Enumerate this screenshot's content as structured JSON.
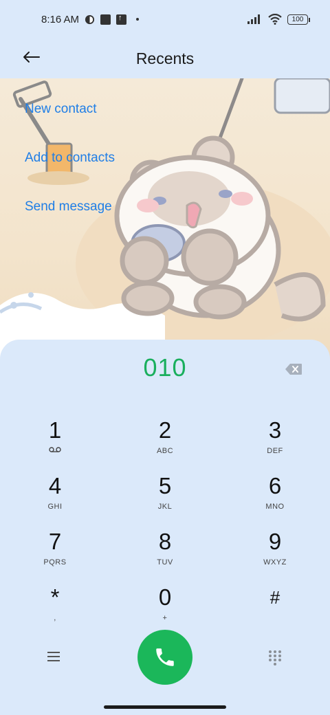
{
  "status_bar": {
    "time": "8:16 AM",
    "icons": [
      "app-notification-icon",
      "square-notification-icon",
      "upload-notification-icon",
      "dot-icon"
    ],
    "right_icons": [
      "signal-icon",
      "wifi-icon",
      "battery-icon"
    ],
    "battery": "100"
  },
  "app_bar": {
    "title": "Recents",
    "back_icon": "back-arrow-icon"
  },
  "quick_actions": [
    {
      "label": "New contact"
    },
    {
      "label": "Add to contacts"
    },
    {
      "label": "Send message"
    }
  ],
  "dialer": {
    "number": "010",
    "backspace_icon": "backspace-icon",
    "keys": [
      {
        "digit": "1",
        "letters": ""
      },
      {
        "digit": "2",
        "letters": "ABC"
      },
      {
        "digit": "3",
        "letters": "DEF"
      },
      {
        "digit": "4",
        "letters": "GHI"
      },
      {
        "digit": "5",
        "letters": "JKL"
      },
      {
        "digit": "6",
        "letters": "MNO"
      },
      {
        "digit": "7",
        "letters": "PQRS"
      },
      {
        "digit": "8",
        "letters": "TUV"
      },
      {
        "digit": "9",
        "letters": "WXYZ"
      },
      {
        "digit": "*",
        "letters": ","
      },
      {
        "digit": "0",
        "letters": "+"
      },
      {
        "digit": "#",
        "letters": ""
      }
    ],
    "bottom": {
      "menu_icon": "menu-icon",
      "call_icon": "phone-icon",
      "keypad_icon": "dialpad-icon"
    }
  },
  "colors": {
    "accent_blue": "#1f7ee6",
    "number_green": "#1aaf5d",
    "call_green": "#1bb75a",
    "panel_bg": "#dbe9fa"
  }
}
